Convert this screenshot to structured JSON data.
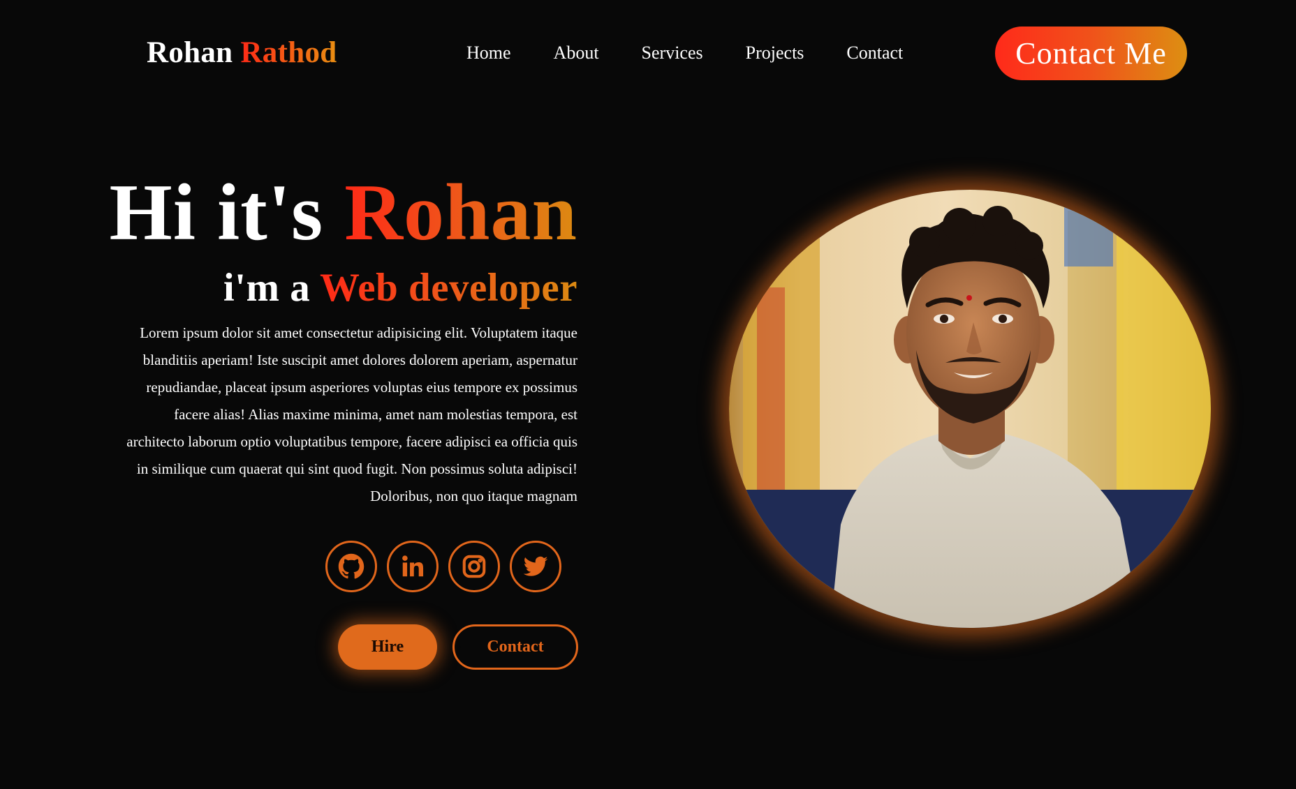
{
  "header": {
    "logo_first": "Rohan",
    "logo_last": "Rathod",
    "nav": [
      {
        "label": "Home"
      },
      {
        "label": "About"
      },
      {
        "label": "Services"
      },
      {
        "label": "Projects"
      },
      {
        "label": "Contact"
      }
    ],
    "cta_label": "Contact Me"
  },
  "hero": {
    "title_prefix": "Hi it's",
    "title_name": "Rohan",
    "subtitle_prefix": "i'm a",
    "subtitle_role": "Web developer",
    "description": "Lorem ipsum dolor sit amet consectetur adipisicing elit. Voluptatem itaque blanditiis aperiam! Iste suscipit amet dolores dolorem aperiam, aspernatur repudiandae, placeat ipsum asperiores voluptas eius tempore ex possimus facere alias! Alias maxime minima, amet nam molestias tempora, est architecto laborum optio voluptatibus tempore, facere adipisci ea officia quis in similique cum quaerat qui sint quod fugit. Non possimus soluta adipisci! Doloribus, non quo itaque magnam",
    "socials": [
      {
        "icon": "github-icon"
      },
      {
        "icon": "linkedin-icon"
      },
      {
        "icon": "instagram-icon"
      },
      {
        "icon": "twitter-icon"
      }
    ],
    "hire_label": "Hire",
    "contact_label": "Contact"
  },
  "colors": {
    "background": "#080808",
    "accent_start": "#ff2a17",
    "accent_end": "#dc8a12",
    "accent_orange": "#e2661b"
  }
}
